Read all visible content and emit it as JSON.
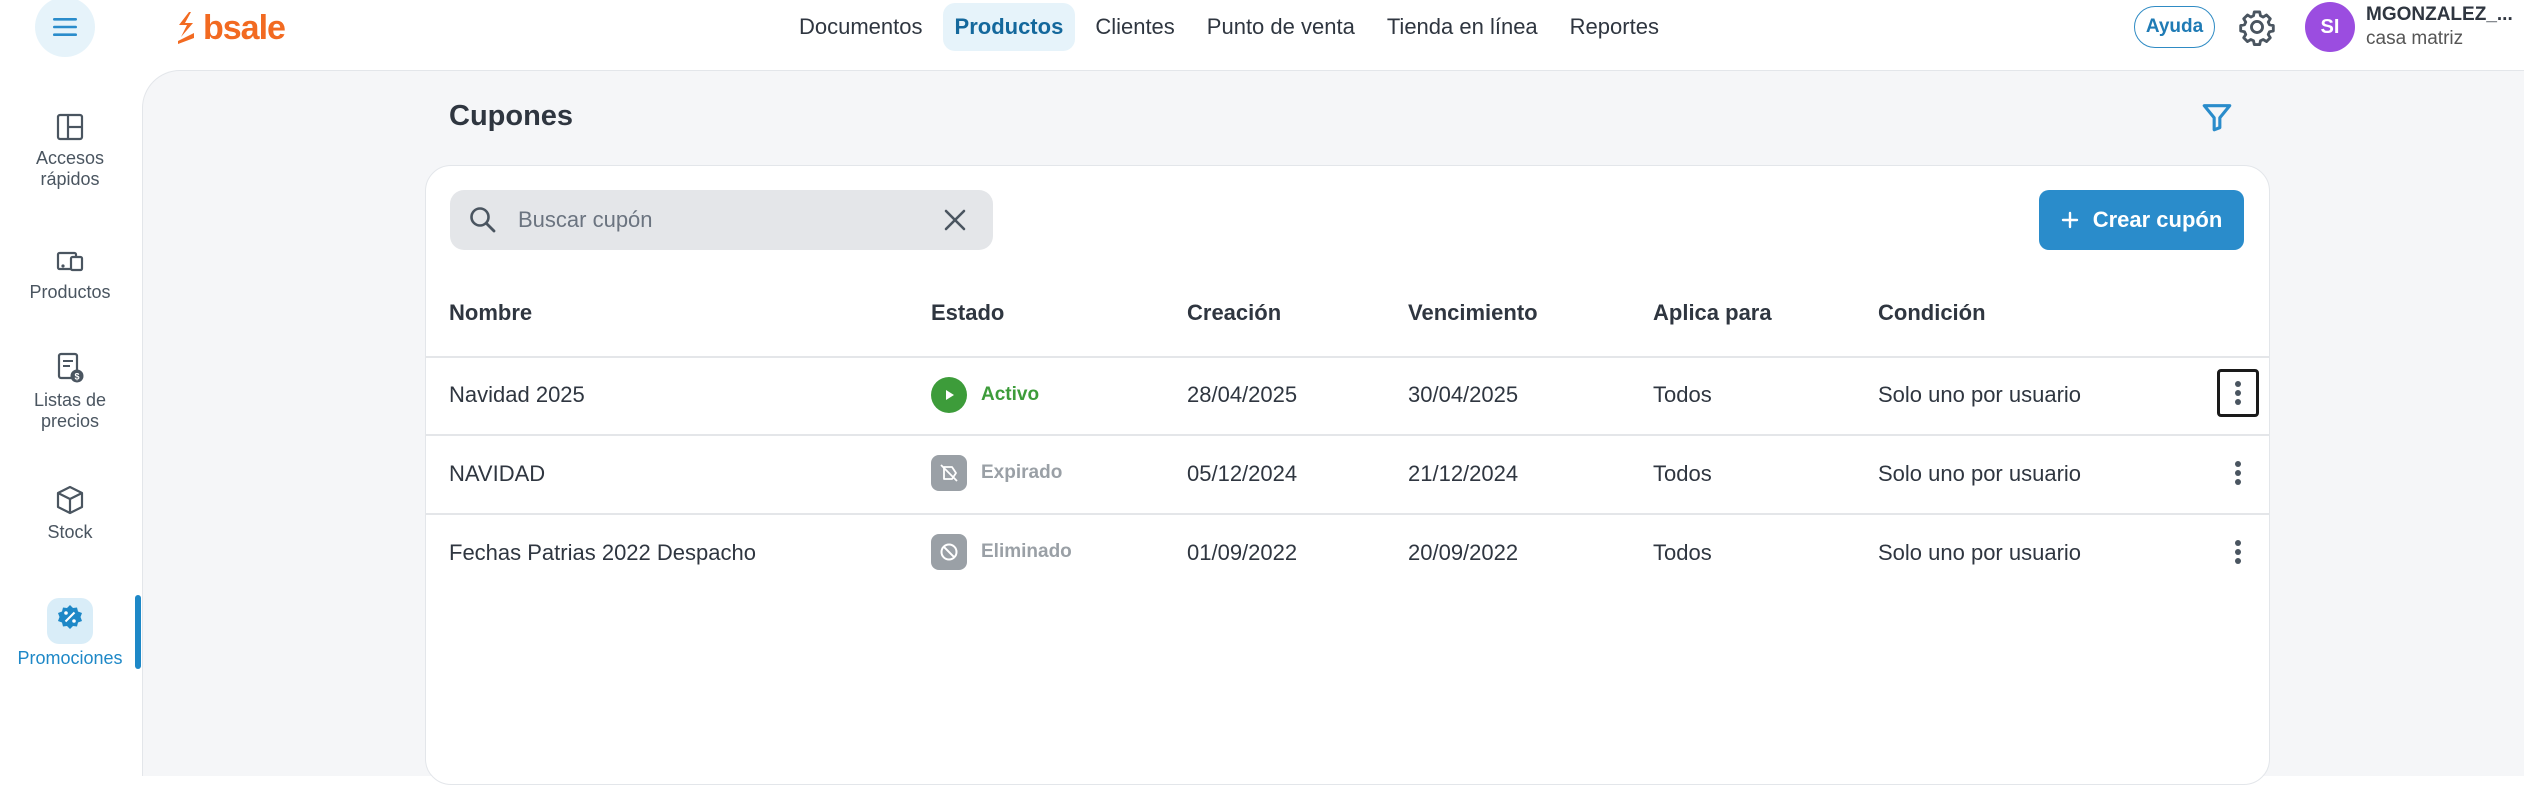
{
  "brand": {
    "name": "bsale",
    "color": "#f26a21"
  },
  "nav": {
    "items": [
      {
        "label": "Documentos",
        "active": false
      },
      {
        "label": "Productos",
        "active": true
      },
      {
        "label": "Clientes",
        "active": false
      },
      {
        "label": "Punto de venta",
        "active": false
      },
      {
        "label": "Tienda en línea",
        "active": false
      },
      {
        "label": "Reportes",
        "active": false
      }
    ]
  },
  "header": {
    "help_label": "Ayuda",
    "avatar_initials": "SI",
    "user_name": "MGONZALEZ_...",
    "branch": "casa matriz"
  },
  "sidebar": {
    "items": [
      {
        "label": "Accesos rápidos",
        "icon": "quick-access-icon"
      },
      {
        "label": "Productos",
        "icon": "products-icon"
      },
      {
        "label": "Listas de precios",
        "icon": "price-list-icon"
      },
      {
        "label": "Stock",
        "icon": "stock-box-icon"
      },
      {
        "label": "Promociones",
        "icon": "promotions-icon",
        "active": true
      }
    ]
  },
  "page": {
    "title": "Cupones",
    "search_placeholder": "Buscar cupón",
    "create_label": "Crear cupón"
  },
  "table": {
    "columns": [
      "Nombre",
      "Estado",
      "Creación",
      "Vencimiento",
      "Aplica para",
      "Condición"
    ],
    "rows": [
      {
        "name": "Navidad 2025",
        "status": "Activo",
        "status_type": "active",
        "created": "28/04/2025",
        "expires": "30/04/2025",
        "applies": "Todos",
        "condition": "Solo uno por usuario"
      },
      {
        "name": "NAVIDAD",
        "status": "Expirado",
        "status_type": "expired",
        "created": "05/12/2024",
        "expires": "21/12/2024",
        "applies": "Todos",
        "condition": "Solo uno por usuario"
      },
      {
        "name": "Fechas Patrias 2022 Despacho",
        "status": "Eliminado",
        "status_type": "deleted",
        "created": "01/09/2022",
        "expires": "20/09/2022",
        "applies": "Todos",
        "condition": "Solo uno por usuario"
      }
    ]
  },
  "colors": {
    "accent": "#2a8ccb",
    "active_status": "#3d9c3a",
    "muted_status": "#9aa0a6"
  }
}
